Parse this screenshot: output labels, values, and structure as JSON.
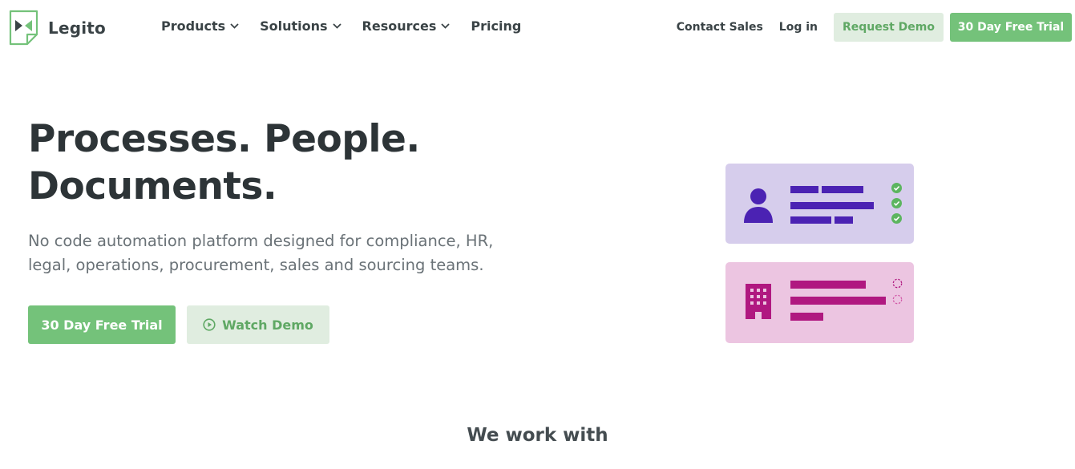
{
  "header": {
    "logo_text": "Legito",
    "nav": [
      {
        "label": "Products",
        "has_dropdown": true
      },
      {
        "label": "Solutions",
        "has_dropdown": true
      },
      {
        "label": "Resources",
        "has_dropdown": true
      },
      {
        "label": "Pricing",
        "has_dropdown": false
      }
    ],
    "contact_label": "Contact Sales",
    "login_label": "Log in",
    "request_demo_label": "Request Demo",
    "trial_label": "30 Day Free Trial"
  },
  "hero": {
    "title_line1": "Processes. People.",
    "title_line2": "Documents.",
    "subtitle_line1": "No code automation platform designed for compliance, HR,",
    "subtitle_line2": "legal, operations, procurement, sales and sourcing teams.",
    "trial_button": "30 Day Free Trial",
    "watch_demo_button": "Watch Demo"
  },
  "illustration": {
    "cards": [
      {
        "icon": "person-icon",
        "status": "check-circle-icon",
        "status_count": 3
      },
      {
        "icon": "building-icon",
        "status": "pending-circle-icon",
        "status_count": 2
      }
    ]
  },
  "section": {
    "heading": "We work with"
  },
  "colors": {
    "brand_green": "#74c27a",
    "brand_green_light": "#e0ede0",
    "text_dark": "#2d3437",
    "text_muted": "#6a7277",
    "card_purple": "#d6cdec",
    "card_purple_accent": "#4b22b3",
    "card_pink": "#ecc5e1",
    "card_pink_accent": "#b01880"
  }
}
